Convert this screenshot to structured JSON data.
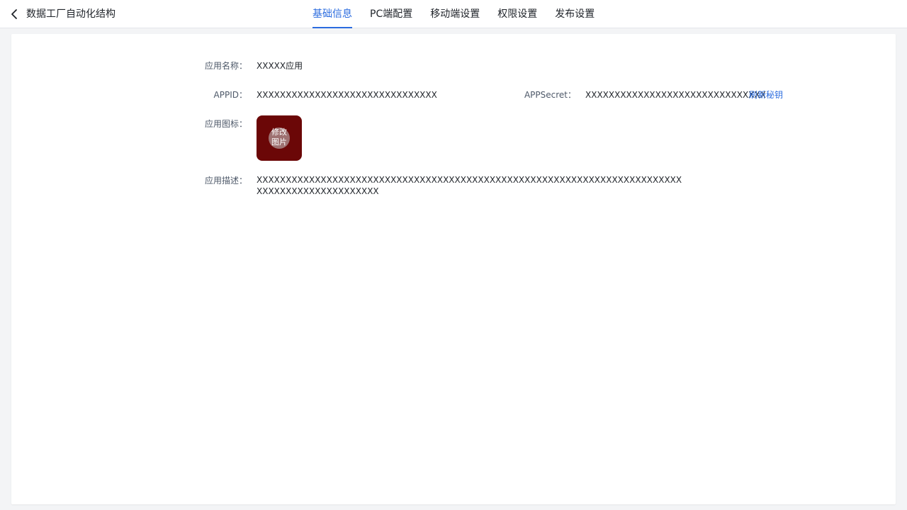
{
  "header": {
    "back_title": "数据工厂自动化结构",
    "tabs": [
      {
        "label": "基础信息",
        "active": true
      },
      {
        "label": "PC端配置",
        "active": false
      },
      {
        "label": "移动端设置",
        "active": false
      },
      {
        "label": "权限设置",
        "active": false
      },
      {
        "label": "发布设置",
        "active": false
      }
    ]
  },
  "form": {
    "app_name_label": "应用名称：",
    "app_name_value": "XXXXX应用",
    "appid_label": "APPID：",
    "appid_value": "XXXXXXXXXXXXXXXXXXXXXXXXXXXXXXX",
    "appsecret_label": "APPSecret：",
    "appsecret_value": "XXXXXXXXXXXXXXXXXXXXXXXXXXXXXXX",
    "refresh_secret_label": "刷新秘钥",
    "app_icon_label": "应用图标：",
    "change_image_line1": "修改",
    "change_image_line2": "图片",
    "app_desc_label": "应用描述：",
    "app_desc_line1": "XXXXXXXXXXXXXXXXXXXXXXXXXXXXXXXXXXXXXXXXXXXXXXXXXXXXXXXXXXXXXXXXXXXXXXXXX",
    "app_desc_line2": "XXXXXXXXXXXXXXXXXXXXX"
  },
  "colors": {
    "accent": "#2b6cdf",
    "icon_background": "#6b0707",
    "page_background": "#f3f4f6"
  },
  "icons": {
    "back": "chevron-left-icon"
  }
}
